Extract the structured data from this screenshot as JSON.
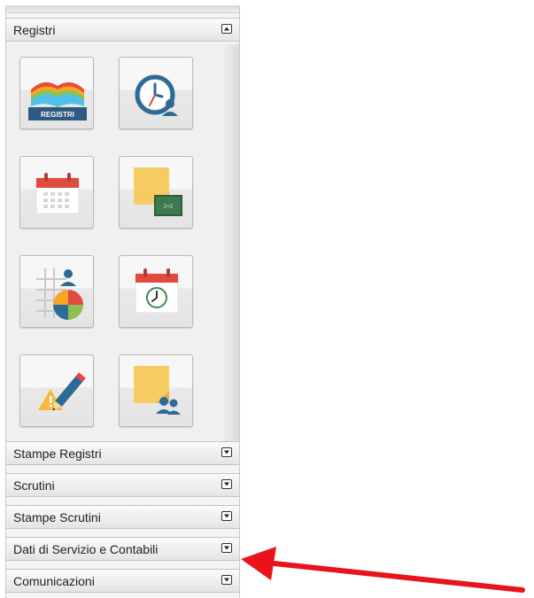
{
  "registri_panel": {
    "title": "Registri",
    "registri_tile_text": "REGISTRI"
  },
  "collapsed_panels": [
    {
      "label": "Stampe Registri"
    },
    {
      "label": "Scrutini"
    },
    {
      "label": "Stampe Scrutini"
    },
    {
      "label": "Dati di Servizio e Contabili"
    },
    {
      "label": "Comunicazioni"
    }
  ],
  "colors": {
    "arrow": "#e8141a",
    "icon_blue": "#2d6a96",
    "calendar_red": "#e04a3f",
    "sticky_yellow": "#f6cc63"
  }
}
